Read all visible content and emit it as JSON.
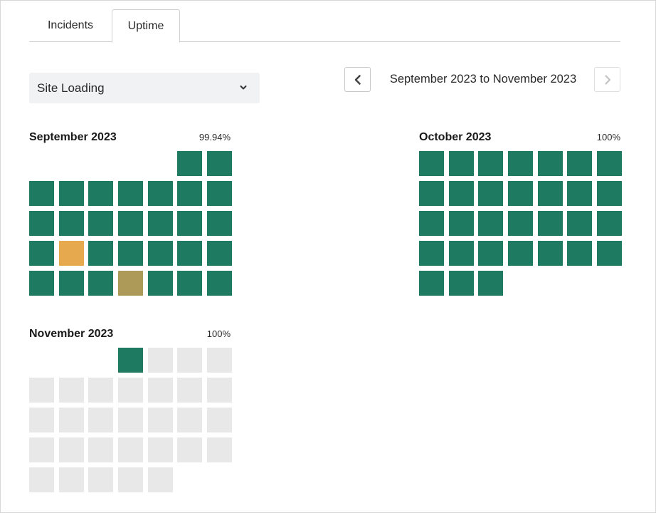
{
  "tabs": [
    {
      "label": "Incidents",
      "active": false
    },
    {
      "label": "Uptime",
      "active": true
    }
  ],
  "site_select": {
    "value": "Site Loading",
    "icon": "chevron-down-icon"
  },
  "range": {
    "label": "September 2023 to November 2023",
    "prev_icon": "chevron-left-icon",
    "next_icon": "chevron-right-icon",
    "next_disabled": true
  },
  "colors": {
    "up": "#1e7a60",
    "degraded": "#e6a94d",
    "partial": "#ad9a58",
    "future": "#e8e8e8"
  },
  "months": [
    {
      "title": "September 2023",
      "uptime": "99.94%",
      "offset": 5,
      "days": [
        "up",
        "up",
        "up",
        "up",
        "up",
        "up",
        "up",
        "up",
        "up",
        "up",
        "up",
        "up",
        "up",
        "up",
        "up",
        "up",
        "up",
        "degraded",
        "up",
        "up",
        "up",
        "up",
        "up",
        "up",
        "up",
        "up",
        "partial",
        "up",
        "up",
        "up"
      ]
    },
    {
      "title": "October 2023",
      "uptime": "100%",
      "offset": 0,
      "days": [
        "up",
        "up",
        "up",
        "up",
        "up",
        "up",
        "up",
        "up",
        "up",
        "up",
        "up",
        "up",
        "up",
        "up",
        "up",
        "up",
        "up",
        "up",
        "up",
        "up",
        "up",
        "up",
        "up",
        "up",
        "up",
        "up",
        "up",
        "up",
        "up",
        "up",
        "up"
      ]
    },
    {
      "title": "November 2023",
      "uptime": "100%",
      "offset": 3,
      "days": [
        "up",
        "future",
        "future",
        "future",
        "future",
        "future",
        "future",
        "future",
        "future",
        "future",
        "future",
        "future",
        "future",
        "future",
        "future",
        "future",
        "future",
        "future",
        "future",
        "future",
        "future",
        "future",
        "future",
        "future",
        "future",
        "future",
        "future",
        "future",
        "future",
        "future"
      ]
    }
  ]
}
